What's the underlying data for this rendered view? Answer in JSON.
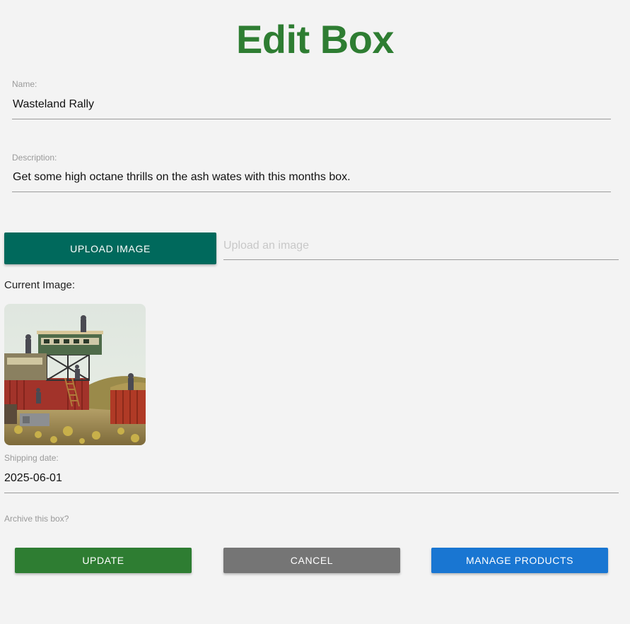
{
  "page": {
    "title": "Edit Box"
  },
  "form": {
    "name": {
      "label": "Name:",
      "value": "Wasteland Rally"
    },
    "description": {
      "label": "Description:",
      "value": "Get some high octane thrills on the ash wates with this months box."
    },
    "upload": {
      "button_label": "UPLOAD IMAGE",
      "placeholder": "Upload an image",
      "value": ""
    },
    "current_image": {
      "label": "Current Image:",
      "image": "wasteland-terrain-miniatures-photo"
    },
    "shipping_date": {
      "label": "Shipping date:",
      "value": "2025-06-01"
    },
    "archive": {
      "label": "Archive this box?"
    }
  },
  "actions": {
    "update_label": "UPDATE",
    "cancel_label": "CANCEL",
    "manage_label": "MANAGE PRODUCTS"
  },
  "colors": {
    "title": "#2e7d32",
    "upload_button": "#00695c",
    "update_button": "#2e7d32",
    "cancel_button": "#757575",
    "manage_button": "#1976d2"
  }
}
